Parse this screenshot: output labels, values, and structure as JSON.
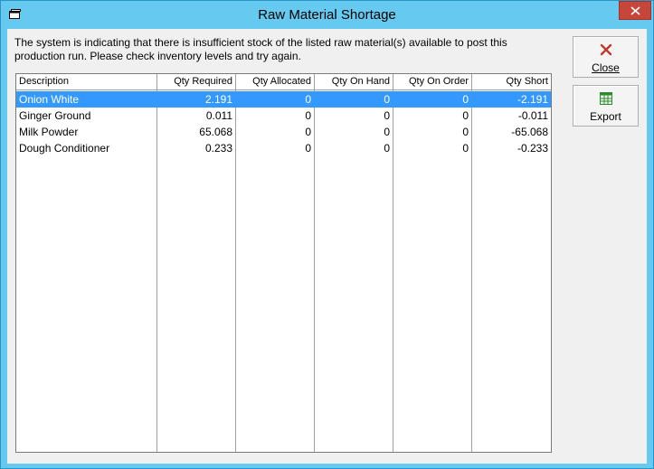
{
  "window": {
    "title": "Raw Material Shortage"
  },
  "message": "The system is indicating that there is insufficient stock of the listed raw material(s) available to post this production run. Please check inventory levels and try again.",
  "buttons": {
    "close_label": "Close",
    "export_label": "Export"
  },
  "table": {
    "columns": [
      "Description",
      "Qty Required",
      "Qty Allocated",
      "Qty On Hand",
      "Qty On Order",
      "Qty Short"
    ],
    "rows": [
      [
        "Onion White",
        "2.191",
        "0",
        "0",
        "0",
        "-2.191"
      ],
      [
        "Ginger Ground",
        "0.011",
        "0",
        "0",
        "0",
        "-0.011"
      ],
      [
        "Milk Powder",
        "65.068",
        "0",
        "0",
        "0",
        "-65.068"
      ],
      [
        "Dough Conditioner",
        "0.233",
        "0",
        "0",
        "0",
        "-0.233"
      ]
    ],
    "selected_row": 0
  },
  "colors": {
    "title_bar": "#66c9ef",
    "close_button": "#c7463b",
    "selection": "#3399ff"
  }
}
